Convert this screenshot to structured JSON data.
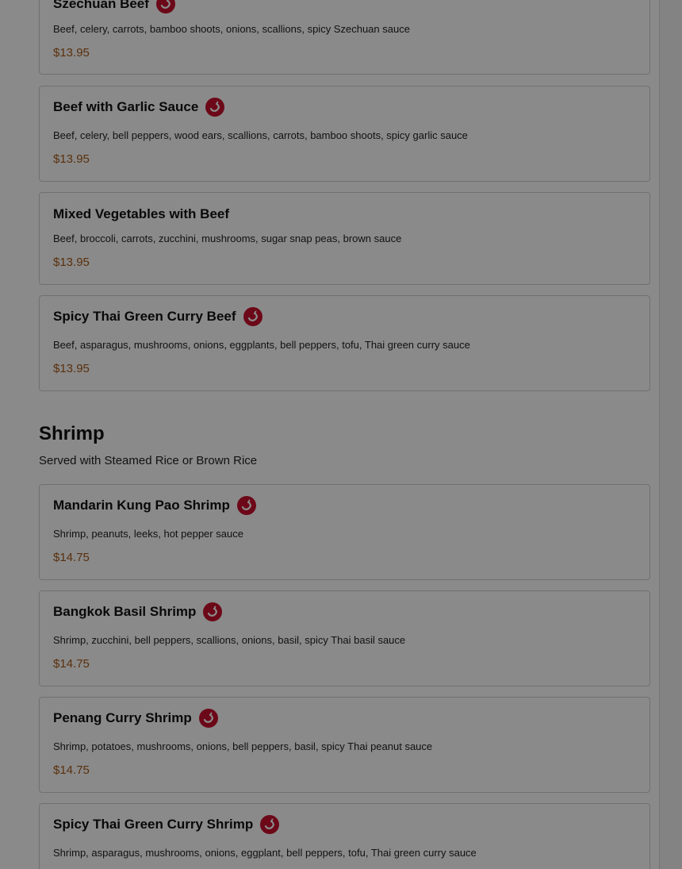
{
  "colors": {
    "spicy_icon": "#c8102e",
    "price": "#a65a18",
    "overlay": "rgba(0,0,0,0.46)"
  },
  "beef_items": [
    {
      "name": "Szechuan Beef",
      "desc": "Beef, celery, carrots, bamboo shoots, onions, scallions, spicy Szechuan sauce",
      "price": "$13.95",
      "spicy": true
    },
    {
      "name": "Beef with Garlic Sauce",
      "desc": "Beef, celery, bell peppers, wood ears, scallions, carrots, bamboo shoots, spicy garlic sauce",
      "price": "$13.95",
      "spicy": true
    },
    {
      "name": "Mixed Vegetables with Beef",
      "desc": "Beef, broccoli, carrots, zucchini, mushrooms, sugar snap peas, brown sauce",
      "price": "$13.95",
      "spicy": false
    },
    {
      "name": "Spicy Thai Green Curry Beef",
      "desc": "Beef, asparagus, mushrooms, onions, eggplants, bell peppers, tofu, Thai green curry sauce",
      "price": "$13.95",
      "spicy": true
    }
  ],
  "shrimp_section": {
    "title": "Shrimp",
    "subtitle": "Served with Steamed Rice or Brown Rice"
  },
  "shrimp_items": [
    {
      "name": "Mandarin Kung Pao Shrimp",
      "desc": "Shrimp, peanuts, leeks, hot pepper sauce",
      "price": "$14.75",
      "spicy": true
    },
    {
      "name": "Bangkok Basil Shrimp",
      "desc": "Shrimp, zucchini, bell peppers, scallions, onions, basil, spicy Thai basil sauce",
      "price": "$14.75",
      "spicy": true
    },
    {
      "name": "Penang Curry Shrimp",
      "desc": "Shrimp, potatoes, mushrooms, onions, bell peppers, basil, spicy Thai peanut sauce",
      "price": "$14.75",
      "spicy": true
    },
    {
      "name": "Spicy Thai Green Curry Shrimp",
      "desc": "Shrimp, asparagus, mushrooms, onions, eggplant, bell peppers, tofu, Thai green curry sauce",
      "price": "",
      "spicy": true
    }
  ]
}
